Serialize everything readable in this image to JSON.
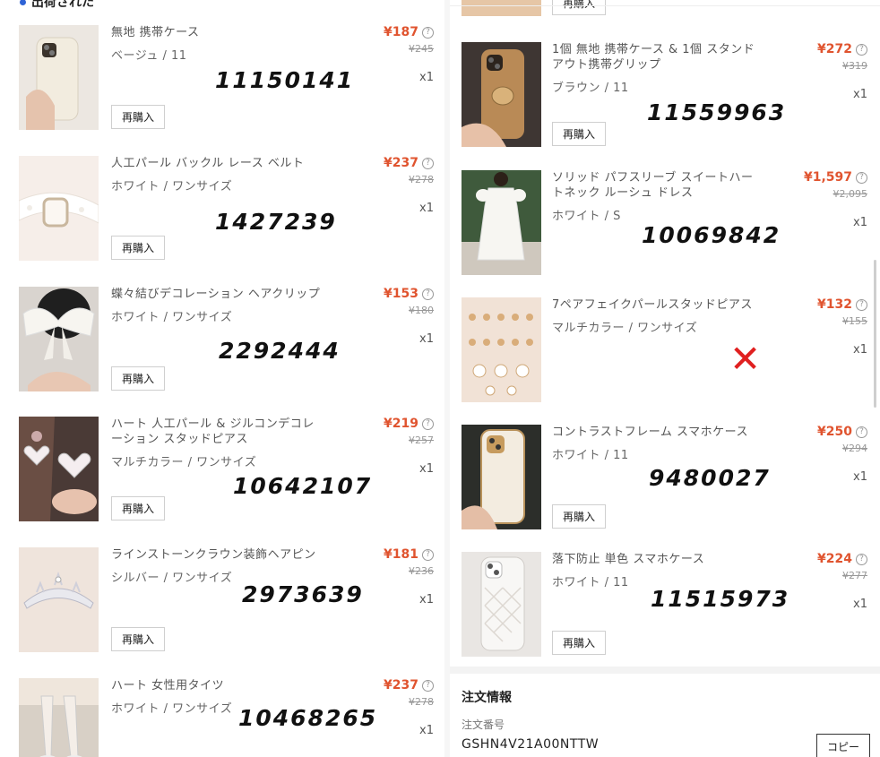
{
  "section": {
    "title": "出荷された"
  },
  "common": {
    "rebuy_label": "再購入",
    "quantity": "x1",
    "info_icon": "?"
  },
  "left_items": [
    {
      "name": "無地 携帯ケース",
      "variant": "ベージュ / 11",
      "price": "¥187",
      "original_price": "¥245",
      "code": "11150141"
    },
    {
      "name": "人工パール バックル レース ベルト",
      "variant": "ホワイト / ワンサイズ",
      "price": "¥237",
      "original_price": "¥278",
      "code": "1427239"
    },
    {
      "name": "蝶々結びデコレーション ヘアクリップ",
      "variant": "ホワイト / ワンサイズ",
      "price": "¥153",
      "original_price": "¥180",
      "code": "2292444"
    },
    {
      "name": "ハート 人工パール & ジルコンデコレーション スタッドピアス",
      "variant": "マルチカラー / ワンサイズ",
      "price": "¥219",
      "original_price": "¥257",
      "code": "10642107"
    },
    {
      "name": "ラインストーンクラウン装飾ヘアピン",
      "variant": "シルバー / ワンサイズ",
      "price": "¥181",
      "original_price": "¥236",
      "code": "2973639"
    },
    {
      "name": "ハート 女性用タイツ",
      "variant": "ホワイト / ワンサイズ",
      "price": "¥237",
      "original_price": "¥278",
      "code": "10468265"
    }
  ],
  "right_items": [
    {
      "name": "1個 無地 携帯ケース & 1個 スタンドアウト携帯グリップ",
      "variant": "ブラウン / 11",
      "price": "¥272",
      "original_price": "¥319",
      "code": "11559963"
    },
    {
      "name": "ソリッド パフスリーブ スイートハートネック ルーシュ ドレス",
      "variant": "ホワイト / S",
      "price": "¥1,597",
      "original_price": "¥2,095",
      "code": "10069842"
    },
    {
      "name": "7ペアフェイクパールスタッドピアス",
      "variant": "マルチカラー / ワンサイズ",
      "price": "¥132",
      "original_price": "¥155",
      "code": "",
      "mark": "✕"
    },
    {
      "name": "コントラストフレーム スマホケース",
      "variant": "ホワイト / 11",
      "price": "¥250",
      "original_price": "¥294",
      "code": "9480027"
    },
    {
      "name": "落下防止 単色 スマホケース",
      "variant": "ホワイト / 11",
      "price": "¥224",
      "original_price": "¥277",
      "code": "11515973"
    }
  ],
  "order_info": {
    "title": "注文情報",
    "number_label": "注文番号",
    "number": "GSHN4V21A00NTTW",
    "copy_label": "コピー"
  },
  "colors": {
    "price": "#e0542f",
    "mark": "#e02020",
    "accent": "#2f63d6"
  }
}
